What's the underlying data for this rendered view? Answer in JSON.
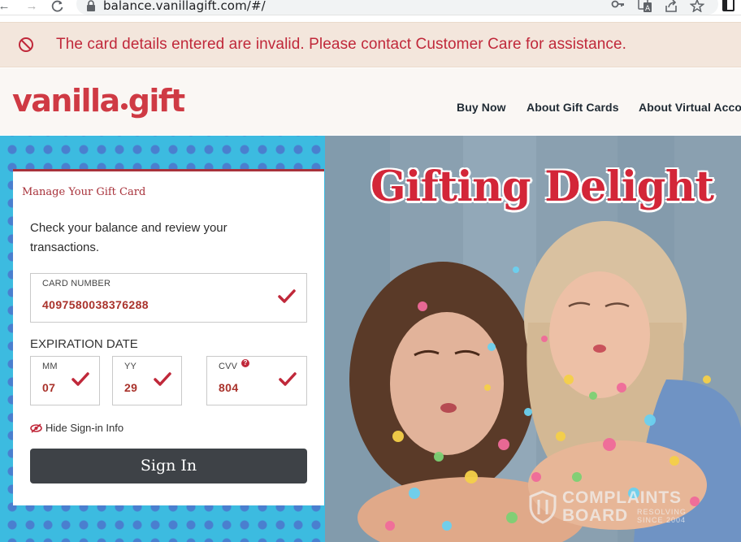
{
  "browser": {
    "url": "balance.vanillagift.com/#/",
    "icons": [
      "back-arrow-icon",
      "forward-arrow-icon",
      "reload-icon",
      "lock-icon",
      "key-icon",
      "translate-icon",
      "share-icon",
      "star-icon",
      "sidebar-icon"
    ]
  },
  "alert": {
    "message": "The card details entered are invalid. Please contact Customer Care for assistance.",
    "icon": "prohibited-icon",
    "color": "#c0283a",
    "background": "#f3e6dc"
  },
  "header": {
    "logo_part1": "vanilla",
    "logo_part2": "gift",
    "nav": [
      "Buy Now",
      "About Gift Cards",
      "About Virtual Accou"
    ]
  },
  "hero": {
    "headline": "Gifting Delight"
  },
  "card": {
    "title": "Manage Your Gift Card",
    "description": "Check your balance and review your transactions.",
    "card_number_label": "CARD NUMBER",
    "card_number_value": "4097580038376288",
    "expiration_label": "EXPIRATION DATE",
    "mm_label": "MM",
    "mm_value": "07",
    "yy_label": "YY",
    "yy_value": "29",
    "cvv_label": "CVV",
    "cvv_value": "804",
    "toggle_label": "Hide Sign-in Info",
    "submit_label": "Sign In"
  },
  "watermark": {
    "line1": "COMPLAINTS",
    "line2": "BOARD",
    "side1": "RESOLVING",
    "side2": "SINCE 2004"
  },
  "colors": {
    "brand": "#cf3a44",
    "field_value": "#a9322b",
    "button": "#3e4247",
    "hero_blue": "#3cbbe0"
  }
}
